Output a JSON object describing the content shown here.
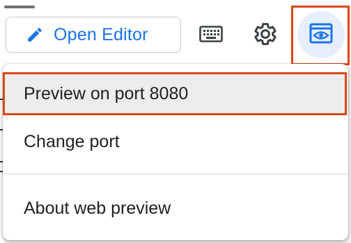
{
  "toolbar": {
    "open_editor": {
      "label": "Open Editor",
      "icon": "pencil-icon"
    },
    "keyboard": {
      "icon": "keyboard-icon"
    },
    "settings": {
      "icon": "gear-icon"
    },
    "web_preview": {
      "icon": "web-preview-icon"
    }
  },
  "menu": {
    "items": [
      {
        "label": "Preview on port 8080",
        "highlighted": true
      },
      {
        "label": "Change port"
      },
      {
        "label": "About web preview"
      }
    ]
  },
  "colors": {
    "accent": "#1a73e8",
    "highlight_outline": "#d9481a",
    "preview_button_bg": "#e7efff",
    "menu_hover_bg": "#ededed",
    "text": "#202124"
  }
}
